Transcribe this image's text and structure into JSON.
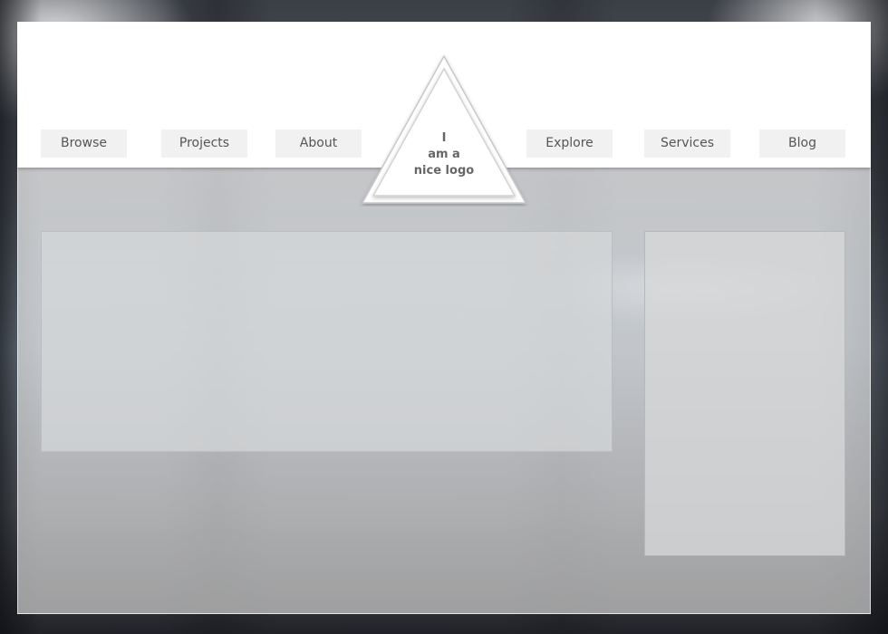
{
  "nav": {
    "browse": "Browse",
    "projects": "Projects",
    "about": "About",
    "explore": "Explore",
    "services": "Services",
    "blog": "Blog"
  },
  "logo": {
    "line1": "I",
    "line2": "am a",
    "line3": "nice logo"
  },
  "colors": {
    "header": "#ffffff",
    "nav_button": "#f1f1f1",
    "nav_text": "#555555",
    "logo_text": "#666666"
  }
}
